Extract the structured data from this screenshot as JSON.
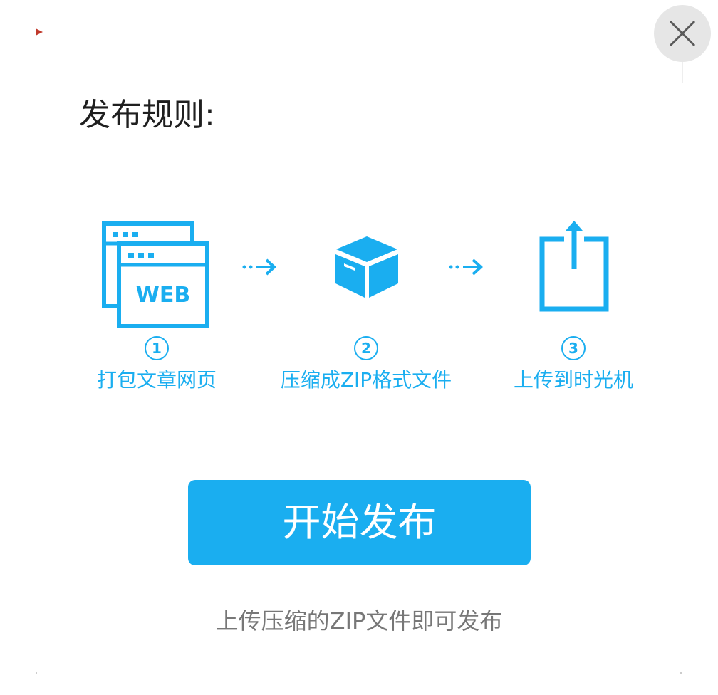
{
  "dialog": {
    "title": "发布规则:",
    "close_icon": "close-icon"
  },
  "steps": [
    {
      "number": "1",
      "label": "打包文章网页",
      "icon": "web-pages-icon",
      "icon_text": "WEB"
    },
    {
      "number": "2",
      "label": "压缩成ZIP格式文件",
      "icon": "box-icon"
    },
    {
      "number": "3",
      "label": "上传到时光机",
      "icon": "upload-icon"
    }
  ],
  "actions": {
    "publish_label": "开始发布"
  },
  "hint": "上传压缩的ZIP文件即可发布",
  "colors": {
    "accent": "#1aaef0",
    "title": "#1f1f1f",
    "hint": "#777777",
    "close_bg": "#e6e6e6"
  }
}
